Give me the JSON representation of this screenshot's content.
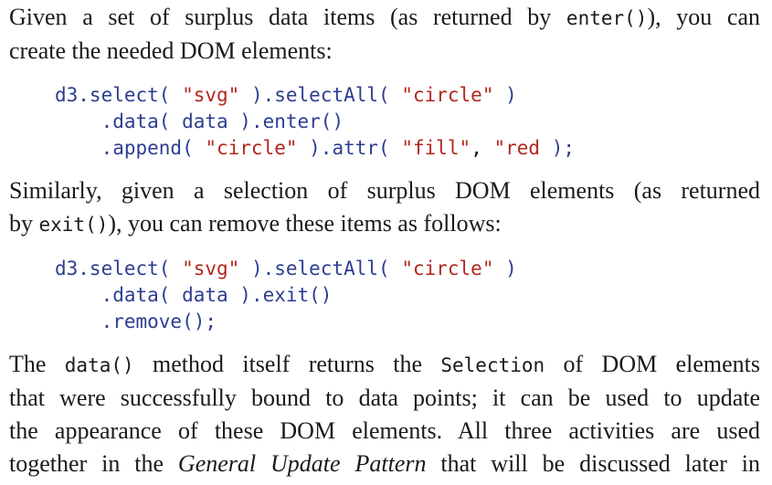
{
  "para1": {
    "line1_pre": "Given a set of surplus data items (as returned by ",
    "line1_code": "enter()",
    "line1_post": "), you can",
    "line2": "create the needed DOM elements:"
  },
  "code1": {
    "l1_a": "d3.select(",
    "l1_b": " \"svg\" ",
    "l1_c": ").selectAll(",
    "l1_d": " \"circle\" ",
    "l1_e": ")",
    "l2_a": "    .data( ",
    "l2_b": "data",
    "l2_c": " ).enter()",
    "l3_a": "    .append(",
    "l3_b": " \"circle\" ",
    "l3_c": ").attr(",
    "l3_d": " \"fill\"",
    "l3_e": ", ",
    "l3_f": "\"red",
    "l3_g": " );"
  },
  "para2": {
    "line1": "Similarly, given a selection of surplus DOM elements (as returned",
    "line2_pre": "by ",
    "line2_code": "exit()",
    "line2_post": "), you can remove these items as follows:"
  },
  "code2": {
    "l1_a": "d3.select(",
    "l1_b": " \"svg\" ",
    "l1_c": ").selectAll(",
    "l1_d": " \"circle\" ",
    "l1_e": ")",
    "l2_a": "    .data( ",
    "l2_b": "data",
    "l2_c": " ).exit()",
    "l3": "    .remove();"
  },
  "para3": {
    "line1_pre": "The ",
    "line1_code1": "data()",
    "line1_mid": " method itself returns the ",
    "line1_code2": "Selection",
    "line1_post": " of DOM elements",
    "line2": "that were successfully bound to data points; it can be used to update",
    "line3": "the appearance of these DOM elements. All three activities are used",
    "line4_pre": "together in the ",
    "line4_em": "General Update Pattern",
    "line4_post": " that will be discussed later in"
  }
}
